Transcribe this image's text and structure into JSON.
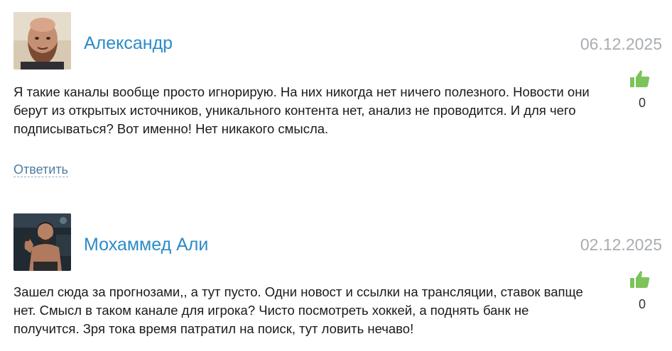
{
  "comments": [
    {
      "author": "Александр",
      "date": "06.12.2025",
      "text": "Я такие каналы вообще просто игнорирую. На них никогда нет ничего полезного. Новости они берут из открытых источников, уникального контента нет, анализ не проводится. И для чего подписываться? Вот именно! Нет никакого смысла.",
      "likes": "0",
      "reply_label": "Ответить",
      "like_icon": "thumbs-up-icon",
      "like_color": "#7cc35a"
    },
    {
      "author": "Мохаммед Али",
      "date": "02.12.2025",
      "text": "Зашел сюда за прогнозами,, а тут пусто. Одни новост и ссылки на трансляции, ставок вапще нет. Смысл в таком канале для игрока? Чисто посмотреть хоккей, а поднять банк не получится. Зря тока время патратил на поиск, тут ловить нечаво!",
      "likes": "0",
      "like_icon": "thumbs-up-icon",
      "like_color": "#7cc35a"
    }
  ],
  "colors": {
    "author": "#2b8bc8",
    "date": "#a8adb2",
    "reply_link": "#4f7ca3"
  }
}
